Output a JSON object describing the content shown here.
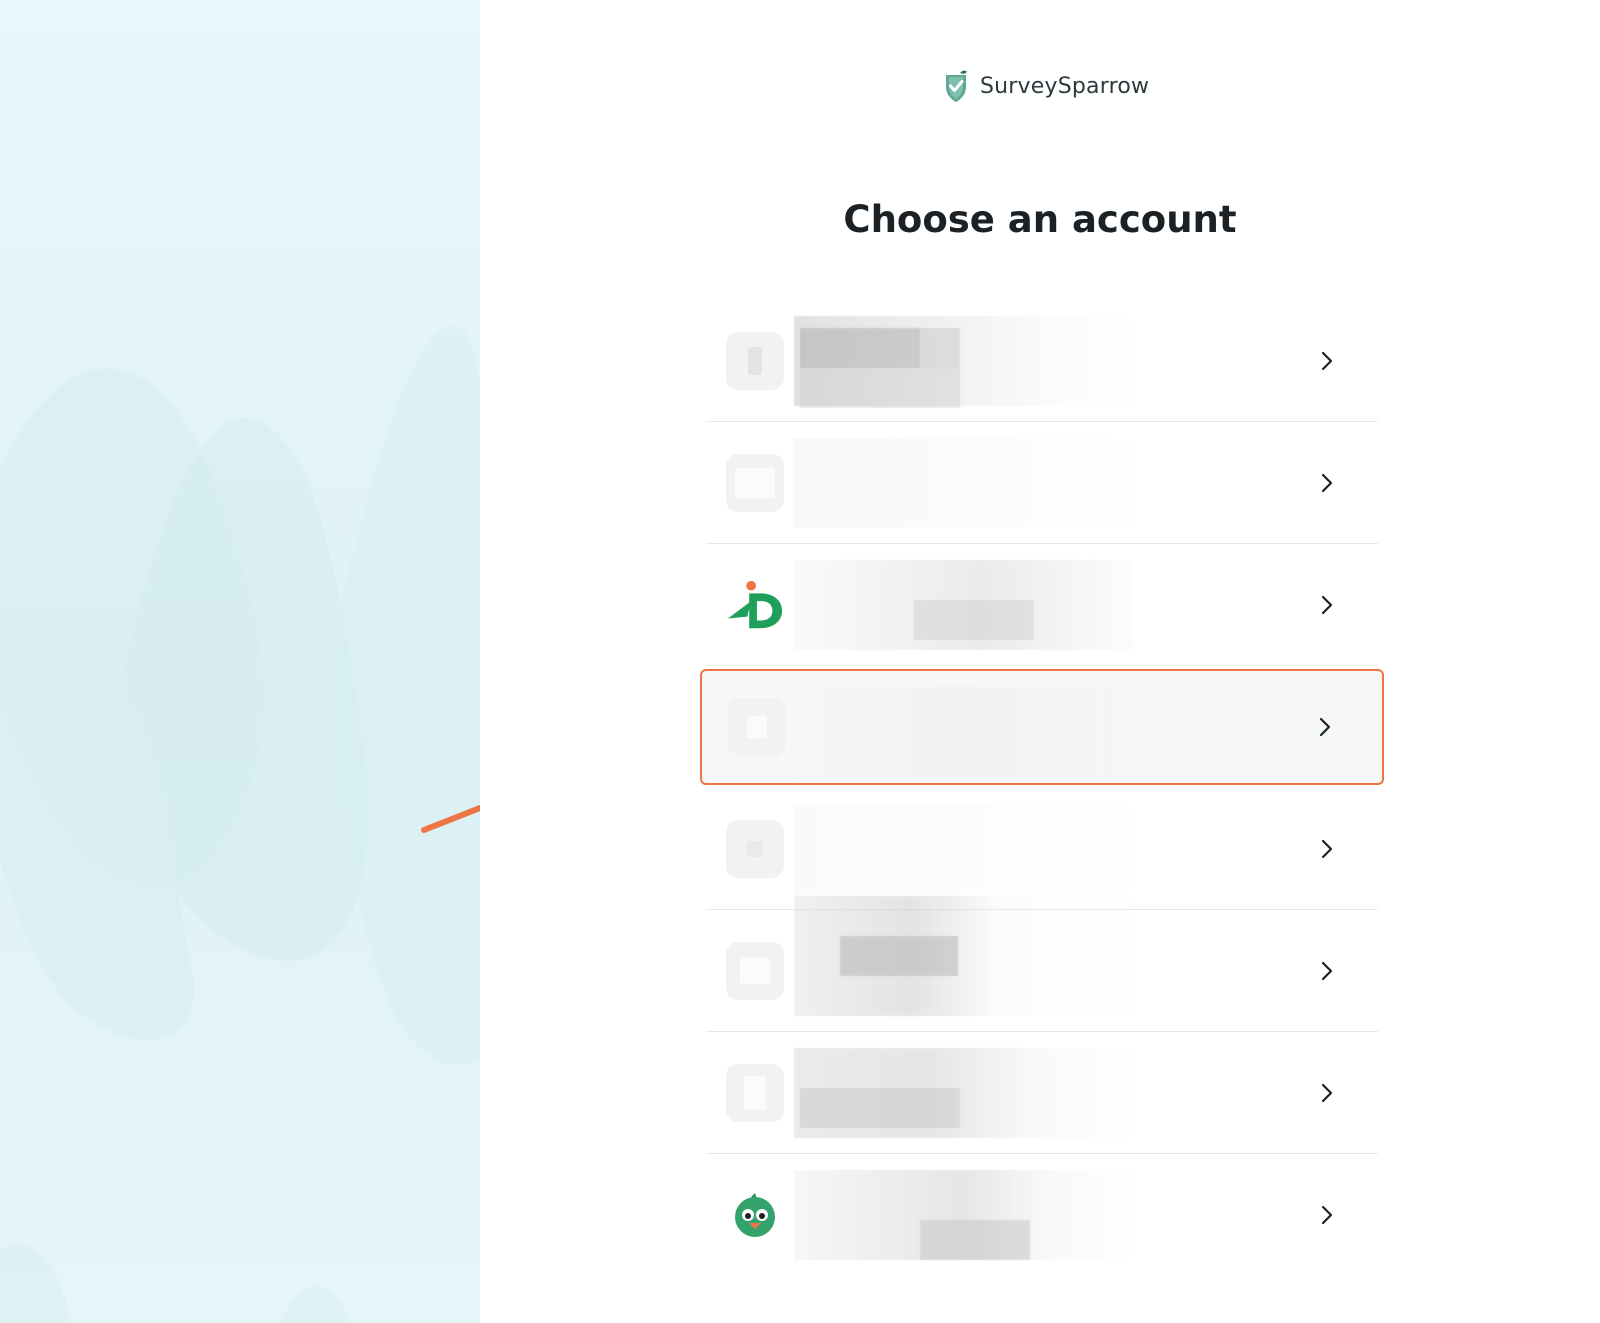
{
  "brand": {
    "name": "SurveySparrow",
    "accent_color": "#2f8f7c"
  },
  "page": {
    "title": "Choose an account"
  },
  "accounts": [
    {
      "avatar": "blank-avatar",
      "name": ""
    },
    {
      "avatar": "blank-avatar",
      "name": ""
    },
    {
      "avatar": "id-logo",
      "name": ""
    },
    {
      "avatar": "blank-avatar",
      "name": "",
      "highlighted": true
    },
    {
      "avatar": "blank-avatar",
      "name": ""
    },
    {
      "avatar": "blank-avatar",
      "name": ""
    },
    {
      "avatar": "blank-avatar",
      "name": ""
    },
    {
      "avatar": "bird-mascot",
      "name": ""
    }
  ],
  "annotation": {
    "arrow_color": "#ef7446",
    "highlight_color": "#ef7446"
  },
  "footer": {
    "text": ""
  }
}
